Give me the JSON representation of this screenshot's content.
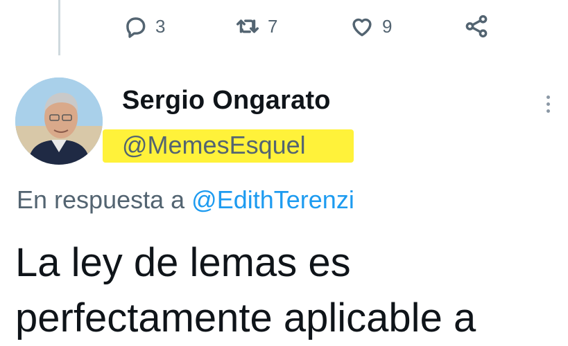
{
  "actions": {
    "reply": {
      "icon": "reply-icon",
      "count": "3"
    },
    "retweet": {
      "icon": "retweet-icon",
      "count": "7"
    },
    "like": {
      "icon": "heart-icon",
      "count": "9"
    },
    "share": {
      "icon": "share-icon"
    }
  },
  "tweet": {
    "author_name": "Sergio Ongarato",
    "author_handle": "@MemesEsquel",
    "reply_prefix": "En respuesta a",
    "reply_mention": "@EdithTerenzi",
    "text_line1": "La ley de lemas es",
    "text_line2": "perfectamente aplicable a"
  },
  "colors": {
    "highlight": "#fff23a",
    "link": "#1d9bf0",
    "secondary_text": "#536471"
  }
}
